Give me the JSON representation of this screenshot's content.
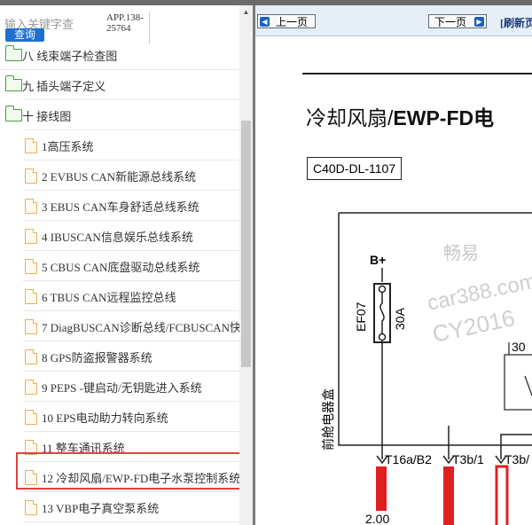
{
  "search": {
    "placeholder": "输入关键字查",
    "button_label": "查询"
  },
  "doc_code": "APP.138-25764",
  "tree": {
    "items": [
      {
        "type": "folder",
        "label": "八 线束端子检查图"
      },
      {
        "type": "folder",
        "label": "九 插头端子定义"
      },
      {
        "type": "folder",
        "label": "十 接线图"
      },
      {
        "type": "page",
        "label": "1高压系统"
      },
      {
        "type": "page",
        "label": "2 EVBUS CAN新能源总线系统"
      },
      {
        "type": "page",
        "label": "3 EBUS CAN车身舒适总线系统"
      },
      {
        "type": "page",
        "label": "4 IBUSCAN信息娱乐总线系统"
      },
      {
        "type": "page",
        "label": "5 CBUS CAN底盘驱动总线系统"
      },
      {
        "type": "page",
        "label": "6 TBUS CAN远程监控总线"
      },
      {
        "type": "page",
        "label": "7 DiagBUSCAN诊断总线/FCBUSCAN快"
      },
      {
        "type": "page",
        "label": "8 GPS防盗报警器系统"
      },
      {
        "type": "page",
        "label": "9 PEPS -键启动/无钥匙进入系统"
      },
      {
        "type": "page",
        "label": "10 EPS电动助力转向系统"
      },
      {
        "type": "page",
        "label": "11 整车通讯系统"
      },
      {
        "type": "page",
        "label": "12 冷却风扇/EWP-FD电子水泵控制系统"
      },
      {
        "type": "page",
        "label": "13 VBP电子真空泵系统"
      }
    ],
    "selected_index": 14
  },
  "toolbar": {
    "prev_label": "上一页",
    "next_label": "下一页",
    "refresh_label": "[刷新页"
  },
  "document": {
    "title_prefix": "冷却风扇/",
    "title_bold": "EWP-FD",
    "title_suffix": "电",
    "code": "C40D-DL-1107"
  },
  "diagram": {
    "supply_label": "B+",
    "fuse_id": "EF07",
    "fuse_rating": "30A",
    "box_label": "前舱电器盒",
    "pin_30": "30",
    "pins": [
      "T16a/B2",
      "T3b/1",
      "T3b/"
    ],
    "wire_size": "2.00",
    "watermark_line1": "畅易",
    "watermark_line2": "car388.com",
    "watermark_line3": "CY2016"
  },
  "colors": {
    "selection": "#e0433b",
    "wire": "#e02020",
    "link": "#1a3a7a",
    "search_button": "#1f6fd0"
  }
}
